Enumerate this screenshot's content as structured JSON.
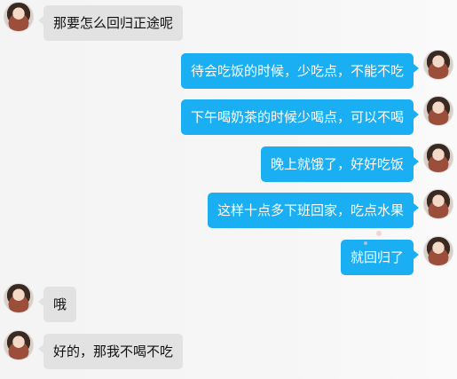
{
  "messages": [
    {
      "side": "left",
      "text": "那要怎么回归正途呢"
    },
    {
      "side": "right",
      "text": "待会吃饭的时候，少吃点，不能不吃"
    },
    {
      "side": "right",
      "text": "下午喝奶茶的时候少喝点，可以不喝"
    },
    {
      "side": "right",
      "text": "晚上就饿了，好好吃饭"
    },
    {
      "side": "right",
      "text": "这样十点多下班回家，吃点水果"
    },
    {
      "side": "right",
      "text": "就回归了"
    },
    {
      "side": "left",
      "text": "哦"
    },
    {
      "side": "left",
      "text": "好的，那我不喝不吃"
    }
  ],
  "colors": {
    "sent_bubble": "#1aaef2",
    "received_bubble": "#e2e2e2"
  }
}
